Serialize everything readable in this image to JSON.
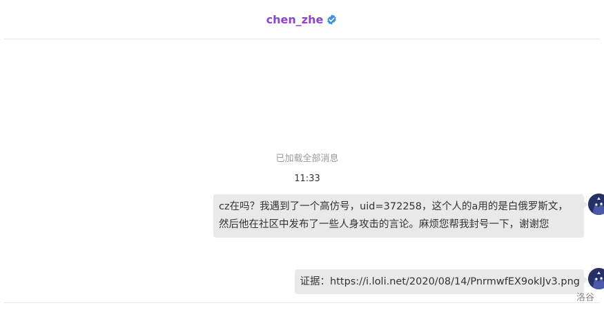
{
  "header": {
    "username": "chen_zhe",
    "verified_icon": "verified-badge-icon",
    "verified_color": "#3d8fd6",
    "username_color": "#8e44c8"
  },
  "conversation": {
    "loaded_all_text": "已加载全部消息",
    "timestamp": "11:33",
    "messages": [
      {
        "text": "cz在吗？我遇到了一个高仿号，uid=372258，这个人的a用的是白俄罗斯文，然后他在社区中发布了一些人身攻击的言论。麻烦您帮我封号一下，谢谢您",
        "sender": "self",
        "avatar_icon": "user-avatar"
      },
      {
        "text": "证据：https://i.loli.net/2020/08/14/PnrmwfEX9okIJv3.png",
        "sender": "self",
        "avatar_icon": "user-avatar"
      }
    ]
  },
  "footer": {
    "watermark": "洛谷"
  }
}
